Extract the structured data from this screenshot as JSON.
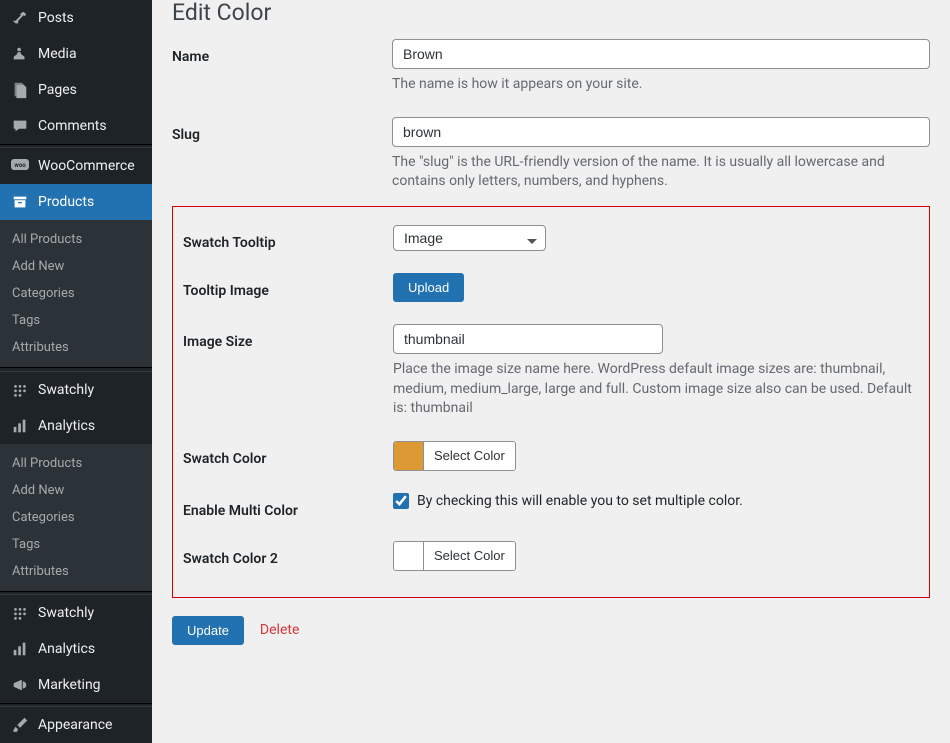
{
  "sidebar": {
    "posts": "Posts",
    "media": "Media",
    "pages": "Pages",
    "comments": "Comments",
    "woocommerce": "WooCommerce",
    "products": "Products",
    "products_sub": {
      "all": "All Products",
      "add": "Add New",
      "categories": "Categories",
      "tags": "Tags",
      "attributes": "Attributes"
    },
    "swatchly": "Swatchly",
    "analytics": "Analytics",
    "dup_sub": {
      "all": "All Products",
      "add": "Add New",
      "categories": "Categories",
      "tags": "Tags",
      "attributes": "Attributes"
    },
    "swatchly2": "Swatchly",
    "analytics2": "Analytics",
    "marketing": "Marketing",
    "appearance": "Appearance"
  },
  "page": {
    "title": "Edit Color",
    "name_label": "Name",
    "name_value": "Brown",
    "name_help": "The name is how it appears on your site.",
    "slug_label": "Slug",
    "slug_value": "brown",
    "slug_help": "The \"slug\" is the URL-friendly version of the name. It is usually all lowercase and contains only letters, numbers, and hyphens.",
    "swatch_tooltip_label": "Swatch Tooltip",
    "swatch_tooltip_value": "Image",
    "tooltip_image_label": "Tooltip Image",
    "upload_btn": "Upload",
    "image_size_label": "Image Size",
    "image_size_value": "thumbnail",
    "image_size_help": "Place the image size name here. WordPress default image sizes are: thumbnail, medium, medium_large, large and full. Custom image size also can be used. Default is: thumbnail",
    "swatch_color_label": "Swatch Color",
    "swatch_color_value": "#dd9933",
    "select_color_btn": "Select Color",
    "enable_multi_label": "Enable Multi Color",
    "enable_multi_help": "By checking this will enable you to set multiple color.",
    "enable_multi_checked": true,
    "swatch_color2_label": "Swatch Color 2",
    "swatch_color2_value": "#ffffff",
    "update_btn": "Update",
    "delete_link": "Delete"
  }
}
